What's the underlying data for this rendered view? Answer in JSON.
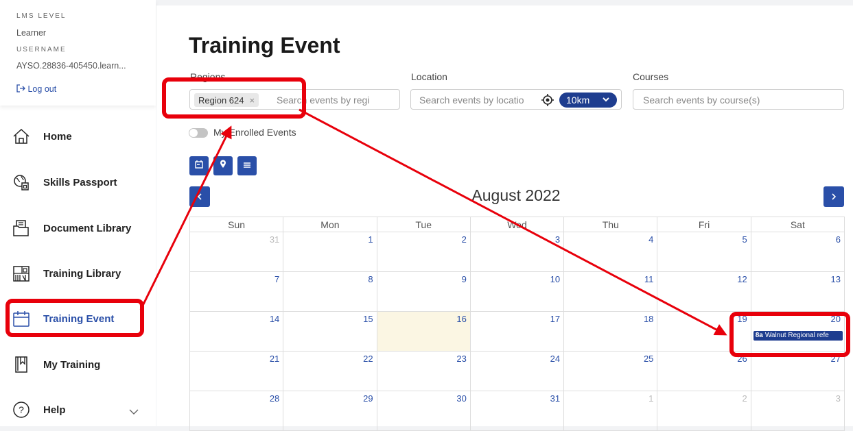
{
  "account": {
    "lms_level_label": "LMS LEVEL",
    "lms_level_value": "Learner",
    "username_label": "USERNAME",
    "username_value": "AYSO.28836-405450.learn...",
    "logout_label": "Log out"
  },
  "nav": {
    "items": [
      {
        "label": "Home",
        "icon": "house-icon"
      },
      {
        "label": "Skills Passport",
        "icon": "passport-icon"
      },
      {
        "label": "Document Library",
        "icon": "folder-icon"
      },
      {
        "label": "Training Library",
        "icon": "library-icon"
      },
      {
        "label": "Training Event",
        "icon": "calendar-icon",
        "active": true
      },
      {
        "label": "My Training",
        "icon": "bookmark-book-icon"
      },
      {
        "label": "Help",
        "icon": "help-circle-icon"
      }
    ]
  },
  "page": {
    "title": "Training Event"
  },
  "filters": {
    "regions_label": "Regions",
    "region_chip": "Region 624",
    "region_chip_remove": "×",
    "regions_placeholder": "Search events by regi",
    "location_label": "Location",
    "location_placeholder": "Search events by locatio",
    "distance_value": "10km",
    "courses_label": "Courses",
    "courses_placeholder": "Search events by course(s)"
  },
  "toggle": {
    "label": "My Enrolled Events",
    "on": false
  },
  "views": [
    "calendar-view-icon",
    "map-view-icon",
    "list-view-icon"
  ],
  "calendar": {
    "month_label": "August 2022",
    "weekdays": [
      "Sun",
      "Mon",
      "Tue",
      "Wed",
      "Thu",
      "Fri",
      "Sat"
    ],
    "weeks": [
      [
        "31",
        "1",
        "2",
        "3",
        "4",
        "5",
        "6"
      ],
      [
        "7",
        "8",
        "9",
        "10",
        "11",
        "12",
        "13"
      ],
      [
        "14",
        "15",
        "16",
        "17",
        "18",
        "19",
        "20"
      ],
      [
        "21",
        "22",
        "23",
        "24",
        "25",
        "26",
        "27"
      ],
      [
        "28",
        "29",
        "30",
        "31",
        "1",
        "2",
        "3"
      ]
    ],
    "event": {
      "time": "8a",
      "title": "Walnut Regional refe"
    }
  },
  "colors": {
    "accent": "#2a4fa8",
    "dark_accent": "#1e3d8f",
    "annotation": "#e8000b",
    "today": "#fbf6e3"
  }
}
